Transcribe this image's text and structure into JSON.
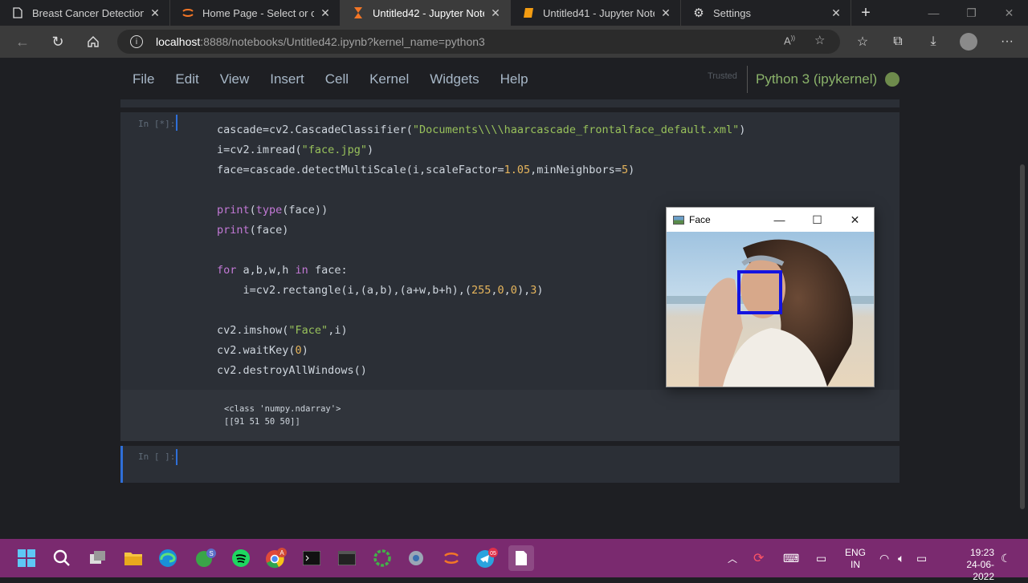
{
  "browser": {
    "tabs": [
      {
        "label": "Breast Cancer Detection",
        "icon": "page-icon",
        "active": false
      },
      {
        "label": "Home Page - Select or crea",
        "icon": "jupyter-icon",
        "active": false
      },
      {
        "label": "Untitled42 - Jupyter Notebo",
        "icon": "hourglass-icon",
        "active": true
      },
      {
        "label": "Untitled41 - Jupyter Notebo",
        "icon": "book-icon",
        "active": false
      },
      {
        "label": "Settings",
        "icon": "gear-icon",
        "active": false
      }
    ],
    "url_host": "localhost",
    "url_path": ":8888/notebooks/Untitled42.ipynb?kernel_name=python3"
  },
  "jupyter": {
    "menu": [
      "File",
      "Edit",
      "View",
      "Insert",
      "Cell",
      "Kernel",
      "Widgets",
      "Help"
    ],
    "trusted": "Trusted",
    "kernel": "Python 3 (ipykernel)"
  },
  "cells": {
    "cell1_prompt": "In [*]:",
    "output_lines": [
      "<class 'numpy.ndarray'>",
      "[[91 51 50 50]]"
    ],
    "cell2_prompt": "In [ ]:"
  },
  "face_window": {
    "title": "Face"
  },
  "taskbar": {
    "lang_line1": "ENG",
    "lang_line2": "IN",
    "time": "19:23",
    "date": "24-06-2022",
    "badges": {
      "skype": "S",
      "chrome": "A",
      "telegram": "05"
    }
  },
  "colors": {
    "accent": "#2f6fd8",
    "kernel_green": "#8bb36a",
    "taskbar": "#7a2a6f"
  }
}
